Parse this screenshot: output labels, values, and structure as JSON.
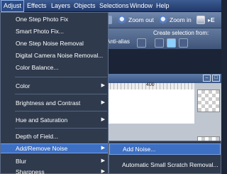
{
  "menubar": {
    "items": [
      {
        "label": "Adjust",
        "active": true
      },
      {
        "label": "Effects"
      },
      {
        "label": "Layers"
      },
      {
        "label": "Objects"
      },
      {
        "label": "Selections"
      },
      {
        "label": "Window"
      },
      {
        "label": "Help"
      }
    ]
  },
  "toolbar": {
    "zoom_out_label": "Zoom out",
    "zoom_in_label": "Zoom in",
    "partial_label": "E"
  },
  "options_bar": {
    "antialias_label": "Anti-alias",
    "create_selection_label": "Create selection from:"
  },
  "image_window": {
    "ruler_label": "400"
  },
  "adjust_menu": {
    "items": [
      {
        "label": "One Step Photo Fix"
      },
      {
        "label": "Smart Photo Fix..."
      },
      {
        "label": "One Step Noise Removal"
      },
      {
        "label": "Digital Camera Noise Removal..."
      },
      {
        "label": "Color Balance..."
      },
      {
        "label": "Color",
        "submenu": true
      },
      {
        "label": "Brightness and Contrast",
        "submenu": true
      },
      {
        "label": "Hue and Saturation",
        "submenu": true
      },
      {
        "label": "Depth of Field..."
      },
      {
        "label": "Add/Remove Noise",
        "submenu": true,
        "highlighted": true
      },
      {
        "label": "Blur",
        "submenu": true
      },
      {
        "label": "Sharpness",
        "submenu": true
      }
    ]
  },
  "noise_submenu": {
    "items": [
      {
        "label": "Add Noise...",
        "highlighted": true
      },
      {
        "label": "Automatic Small Scratch Removal..."
      }
    ]
  },
  "icons": {
    "submenu_arrow": "chevron-right-icon"
  },
  "colors": {
    "menu_bg": "#2f3a4d",
    "highlight": "#3d6fc3",
    "menubar": "#2b4575"
  }
}
